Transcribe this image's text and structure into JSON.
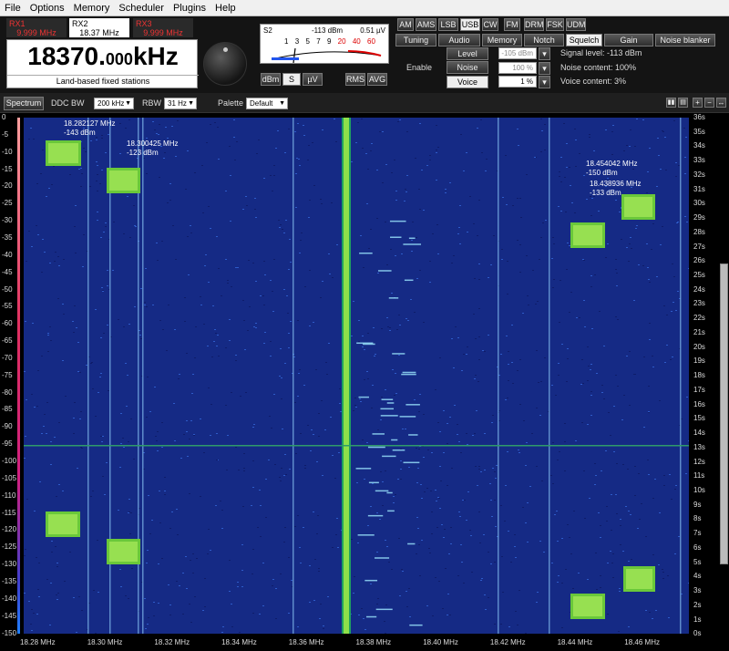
{
  "menu": [
    "File",
    "Options",
    "Memory",
    "Scheduler",
    "Plugins",
    "Help"
  ],
  "rx": [
    {
      "name": "RX1",
      "freq": "9.999 MHz"
    },
    {
      "name": "RX2",
      "freq": "18.37 MHz"
    },
    {
      "name": "RX3",
      "freq": "9.999 MHz"
    }
  ],
  "frequency": {
    "main": "18370.",
    "decimals": "000",
    "unit": "kHz"
  },
  "station": "Land-based fixed stations",
  "smeter": {
    "unit_left": "S2",
    "dbm": "-113 dBm",
    "uv": "0.51 µV",
    "scale": [
      "1",
      "3",
      "5",
      "7",
      "9",
      "20",
      "40",
      "60"
    ],
    "modes": [
      "dBm",
      "S",
      "µV",
      "RMS",
      "AVG"
    ]
  },
  "demod": {
    "modes": [
      "AM",
      "AMS",
      "LSB",
      "USB",
      "CW",
      "FM",
      "DRM",
      "FSK",
      "UDM"
    ],
    "active": "USB"
  },
  "tabs": {
    "items": [
      "Tuning",
      "Audio",
      "Memory",
      "Notch",
      "Squelch",
      "Gain",
      "Noise blanker"
    ],
    "active": "Squelch"
  },
  "squelch": {
    "enable": "Enable",
    "level_btn": "Level",
    "noise_btn": "Noise",
    "voice_btn": "Voice",
    "level_val": "-105 dBm",
    "noise_val": "100 %",
    "voice_val": "1 %",
    "signal_level": "Signal level: -113 dBm",
    "noise_content": "Noise content: 100%",
    "voice_content": "Voice content: 3%"
  },
  "spectrum_bar": {
    "spectrum": "Spectrum",
    "ddc_label": "DDC BW",
    "ddc": "200 kHz",
    "rbw_label": "RBW",
    "rbw": "31 Hz",
    "palette_label": "Palette",
    "palette": "Default"
  },
  "y_left": [
    "0",
    "-5",
    "-10",
    "-15",
    "-20",
    "-25",
    "-30",
    "-35",
    "-40",
    "-45",
    "-50",
    "-55",
    "-60",
    "-65",
    "-70",
    "-75",
    "-80",
    "-85",
    "-90",
    "-95",
    "-100",
    "-105",
    "-110",
    "-115",
    "-120",
    "-125",
    "-130",
    "-135",
    "-140",
    "-145",
    "-150"
  ],
  "y_right": [
    "36s",
    "35s",
    "34s",
    "33s",
    "32s",
    "31s",
    "30s",
    "29s",
    "28s",
    "27s",
    "26s",
    "25s",
    "24s",
    "23s",
    "22s",
    "21s",
    "20s",
    "19s",
    "18s",
    "17s",
    "16s",
    "15s",
    "14s",
    "13s",
    "12s",
    "11s",
    "10s",
    "9s",
    "8s",
    "7s",
    "6s",
    "5s",
    "4s",
    "3s",
    "2s",
    "1s",
    "0s"
  ],
  "x_axis": [
    "18.28 MHz",
    "18.30 MHz",
    "18.32 MHz",
    "18.34 MHz",
    "18.36 MHz",
    "18.38 MHz",
    "18.40 MHz",
    "18.42 MHz",
    "18.44 MHz",
    "18.46 MHz"
  ],
  "markers": [
    {
      "f": "18.282127 MHz",
      "l": "-143 dBm"
    },
    {
      "f": "18.300425 MHz",
      "l": "-123 dBm"
    },
    {
      "f": "18.454042 MHz",
      "l": "-150 dBm"
    },
    {
      "f": "18.438936 MHz",
      "l": "-133 dBm"
    }
  ],
  "colors": {
    "waterfall_bg": "#152a85",
    "signal": "#8ee04a",
    "cursor": "#2f9a6a"
  }
}
